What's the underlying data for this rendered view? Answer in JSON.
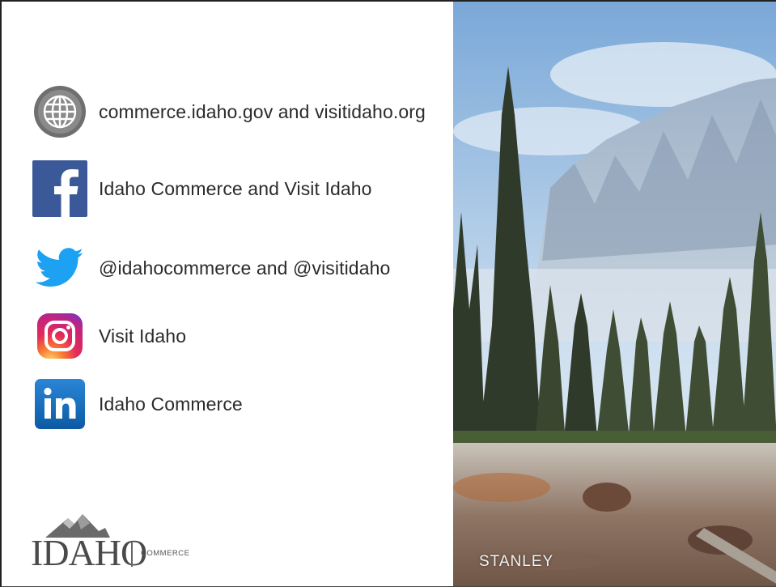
{
  "contacts": [
    {
      "icon": "globe-icon",
      "label": "commerce.idaho.gov and visitidaho.org"
    },
    {
      "icon": "facebook-icon",
      "label": "Idaho Commerce and Visit Idaho"
    },
    {
      "icon": "twitter-icon",
      "label": "@idahocommerce and @visitidaho"
    },
    {
      "icon": "instagram-icon",
      "label": "Visit Idaho"
    },
    {
      "icon": "linkedin-icon",
      "label": "Idaho Commerce"
    }
  ],
  "photo": {
    "caption": "STANLEY"
  },
  "logo": {
    "word": "IDAHO",
    "sub": "COMMERCE"
  },
  "colors": {
    "facebook": "#3b5998",
    "twitter": "#1da1f2",
    "linkedin": "#1666b5",
    "globe": "#7a7a7a"
  }
}
